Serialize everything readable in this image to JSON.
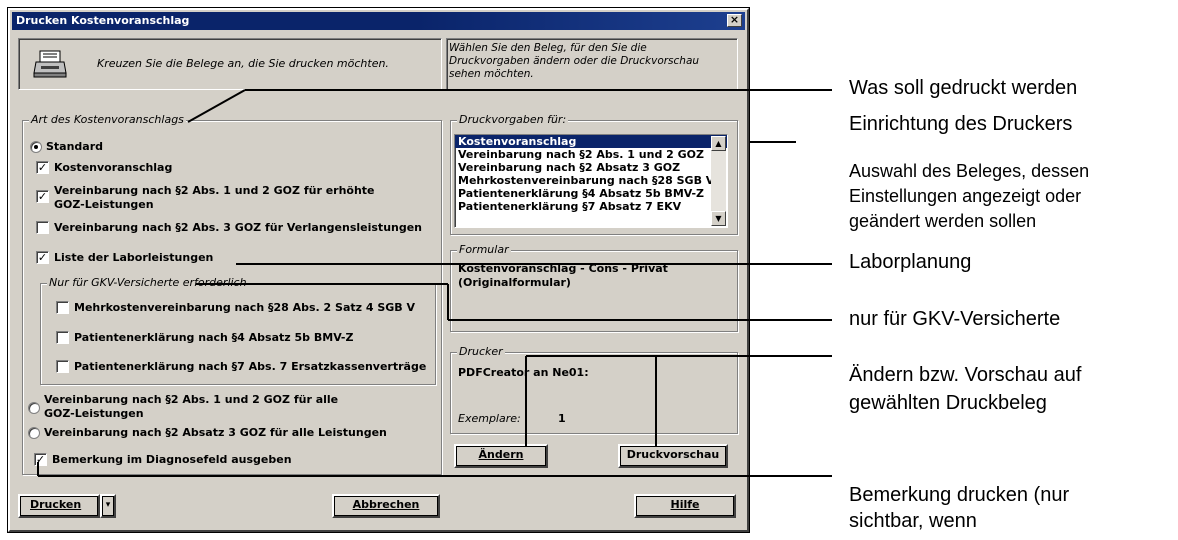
{
  "dialog": {
    "title": "Drucken Kostenvoranschlag",
    "close": "×",
    "info_text": "Kreuzen Sie die Belege an, die Sie drucken möchten.",
    "help_text_1": "Wählen Sie den Beleg, für den Sie die",
    "help_text_2": "Druckvorgaben ändern oder die Druckvorschau",
    "help_text_3": "sehen möchten."
  },
  "art": {
    "legend": "Art des Kostenvoranschlags",
    "standard": "Standard",
    "kostenvoranschlag": "Kostenvoranschlag",
    "vereinbarung1_l1": "Vereinbarung nach §2 Abs. 1 und 2 GOZ für erhöhte",
    "vereinbarung1_l2": "GOZ-Leistungen",
    "vereinbarung3": "Vereinbarung nach §2 Abs. 3 GOZ für Verlangensleistungen",
    "labor": "Liste der Laborleistungen",
    "gkv_legend": "Nur für GKV-Versicherte erforderlich",
    "mehrkosten": "Mehrkostenvereinbarung nach §28 Abs. 2 Satz 4 SGB V",
    "patient4": "Patientenerklärung nach §4 Absatz 5b BMV-Z",
    "patient7": "Patientenerklärung nach §7 Abs. 7 Ersatzkassenverträge",
    "radio2_l1": "Vereinbarung nach §2 Abs. 1 und 2 GOZ für alle",
    "radio2_l2": "GOZ-Leistungen",
    "radio3": "Vereinbarung nach §2 Absatz 3 GOZ für alle Leistungen",
    "bemerkung": "Bemerkung im Diagnosefeld ausgeben",
    "checked": "✓"
  },
  "druckvorgaben": {
    "legend": "Druckvorgaben für:",
    "items": [
      "Kostenvoranschlag",
      "Vereinbarung nach §2 Abs. 1 und 2 GOZ",
      "Vereinbarung nach §2 Absatz 3 GOZ",
      "Mehrkostenvereinbarung nach §28 SGB V",
      "Patientenerklärung §4 Absatz 5b BMV-Z",
      "Patientenerklärung §7 Absatz 7 EKV"
    ]
  },
  "formular": {
    "legend": "Formular",
    "line1": "Kostenvoranschlag - Cons - Privat",
    "line2": "(Originalformular)"
  },
  "drucker": {
    "legend": "Drucker",
    "name": "PDFCreator an Ne01:",
    "exemplare_label": "Exemplare:",
    "exemplare_value": "1"
  },
  "buttons": {
    "aendern": "Ändern",
    "vorschau": "Druckvorschau",
    "drucken": "Drucken",
    "abbrechen": "Abbrechen",
    "hilfe": "Hilfe",
    "dropdown": "▾"
  },
  "annotations": {
    "was_soll": "Was soll gedruckt werden",
    "einrichtung": "Einrichtung des Druckers",
    "auswahl_l1": "Auswahl des Beleges, dessen",
    "auswahl_l2": "Einstellungen angezeigt oder",
    "auswahl_l3": "geändert werden sollen",
    "labor": "Laborplanung",
    "gkv": "nur für GKV-Versicherte",
    "aendern_l1": "Ändern bzw. Vorschau auf",
    "aendern_l2": "gewählten Druckbeleg",
    "bemerkung_l1": "Bemerkung drucken (nur",
    "bemerkung_l2": "sichtbar, wenn"
  }
}
